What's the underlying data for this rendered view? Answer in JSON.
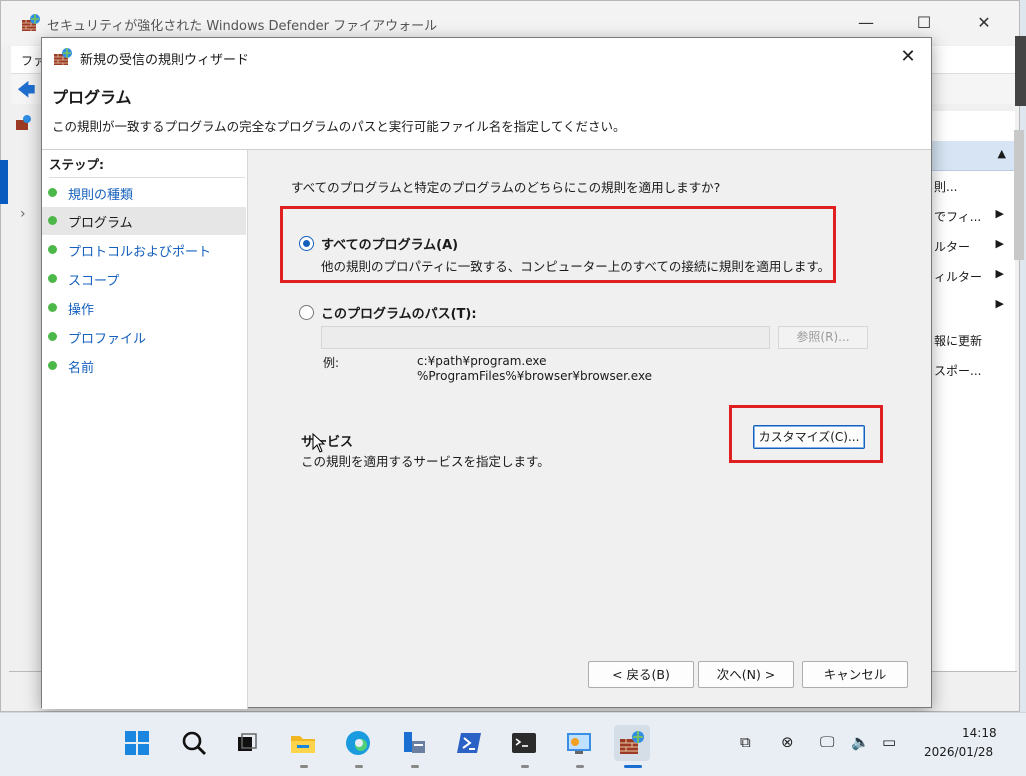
{
  "background_window": {
    "title": "セキュリティが強化された Windows Defender ファイアウォール",
    "menu_file": "ファ",
    "actions": [
      {
        "label": "則...",
        "arrow": false
      },
      {
        "label": "でフィ...",
        "arrow": true
      },
      {
        "label": "ルター",
        "arrow": true
      },
      {
        "label": "ィルター",
        "arrow": true
      },
      {
        "label": "",
        "arrow": true
      },
      {
        "label": "報に更新",
        "arrow": false
      },
      {
        "label": "スポー...",
        "arrow": false
      }
    ]
  },
  "dialog": {
    "title": "新規の受信の規則ウィザード",
    "header_title": "プログラム",
    "header_desc": "この規則が一致するプログラムの完全なプログラムのパスと実行可能ファイル名を指定してください。",
    "steps_title": "ステップ:",
    "steps": [
      {
        "label": "規則の種類",
        "active": false
      },
      {
        "label": "プログラム",
        "active": true
      },
      {
        "label": "プロトコルおよびポート",
        "active": false
      },
      {
        "label": "スコープ",
        "active": false
      },
      {
        "label": "操作",
        "active": false
      },
      {
        "label": "プロファイル",
        "active": false
      },
      {
        "label": "名前",
        "active": false
      }
    ],
    "question": "すべてのプログラムと特定のプログラムのどちらにこの規則を適用しますか?",
    "option_all": {
      "label": "すべてのプログラム(A)",
      "desc": "他の規則のプロパティに一致する、コンピューター上のすべての接続に規則を適用します。",
      "checked": true
    },
    "option_path": {
      "label": "このプログラムのパス(T):",
      "value": "",
      "checked": false
    },
    "browse_label": "参照(R)...",
    "example_label": "例:",
    "example_lines": [
      "c:¥path¥program.exe",
      "%ProgramFiles%¥browser¥browser.exe"
    ],
    "services_title": "サービス",
    "services_desc": "この規則を適用するサービスを指定します。",
    "customize_label": "カスタマイズ(C)...",
    "back_label": "< 戻る(B)",
    "next_label": "次へ(N) >",
    "cancel_label": "キャンセル"
  },
  "taskbar": {
    "apps": [
      "start",
      "search",
      "task-view",
      "file-explorer",
      "edge",
      "server-manager",
      "powershell",
      "terminal",
      "control-panel",
      "firewall"
    ],
    "clock_time": "14:18",
    "clock_date": "2026/01/28"
  },
  "colors": {
    "accent": "#1560bd",
    "highlight": "#e02020",
    "step_dot": "#4db84a"
  }
}
